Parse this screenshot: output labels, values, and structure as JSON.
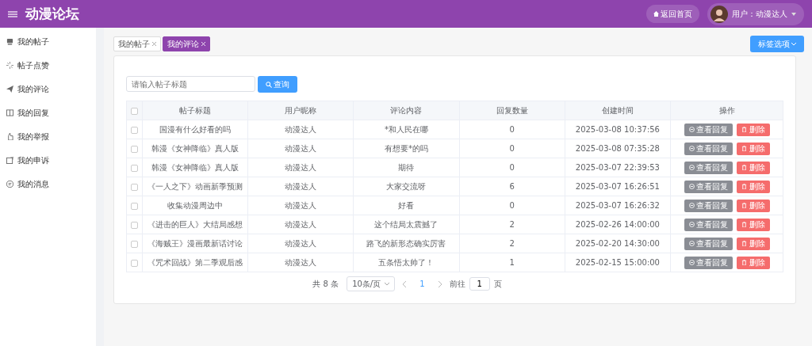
{
  "header": {
    "title": "动漫论坛",
    "home_button": "返回首页",
    "user_label": "用户：动漫达人"
  },
  "sidebar": {
    "items": [
      {
        "label": "我的帖子",
        "selected": false
      },
      {
        "label": "帖子点赞",
        "selected": false
      },
      {
        "label": "我的评论",
        "selected": false
      },
      {
        "label": "我的回复",
        "selected": false
      },
      {
        "label": "我的举报",
        "selected": false
      },
      {
        "label": "我的申诉",
        "selected": false
      },
      {
        "label": "我的消息",
        "selected": false
      }
    ]
  },
  "tabs": [
    {
      "label": "我的帖子",
      "selected": false
    },
    {
      "label": "我的评论",
      "selected": true
    }
  ],
  "tab_options_button": "标签选项",
  "search": {
    "placeholder": "请输入帖子标题",
    "button": "查询"
  },
  "table": {
    "select_all_checked": false,
    "columns": [
      "帖子标题",
      "用户昵称",
      "评论内容",
      "回复数量",
      "创建时间",
      "操作"
    ],
    "rows": [
      {
        "checked": false,
        "cells": [
          "国漫有什么好看的吗",
          "动漫达人",
          "*和人民在哪",
          "0",
          "2025-03-08 10:37:56"
        ],
        "view_button": "查看回复",
        "delete_button": "删除"
      },
      {
        "checked": false,
        "cells": [
          "韩漫《女神降临》真人版",
          "动漫达人",
          "有想要*的吗",
          "0",
          "2025-03-08 07:35:28"
        ],
        "view_button": "查看回复",
        "delete_button": "删除"
      },
      {
        "checked": false,
        "cells": [
          "韩漫《女神降临》真人版",
          "动漫达人",
          "期待",
          "0",
          "2025-03-07 22:39:53"
        ],
        "view_button": "查看回复",
        "delete_button": "删除"
      },
      {
        "checked": false,
        "cells": [
          "《一人之下》动画新季预测",
          "动漫达人",
          "大家交流呀",
          "6",
          "2025-03-07 16:26:51"
        ],
        "view_button": "查看回复",
        "delete_button": "删除"
      },
      {
        "checked": false,
        "cells": [
          "收集动漫周边中",
          "动漫达人",
          "好看",
          "0",
          "2025-03-07 16:26:32"
        ],
        "view_button": "查看回复",
        "delete_button": "删除"
      },
      {
        "checked": false,
        "cells": [
          "《进击的巨人》大结局感想",
          "动漫达人",
          "这个结局太震撼了",
          "2",
          "2025-02-26 14:00:00"
        ],
        "view_button": "查看回复",
        "delete_button": "删除"
      },
      {
        "checked": false,
        "cells": [
          "《海贼王》漫画最新话讨论",
          "动漫达人",
          "路飞的新形态确实厉害",
          "2",
          "2025-02-20 14:30:00"
        ],
        "view_button": "查看回复",
        "delete_button": "删除"
      },
      {
        "checked": false,
        "cells": [
          "《咒术回战》第二季观后感",
          "动漫达人",
          "五条悟太帅了！",
          "1",
          "2025-02-15 15:00:00"
        ],
        "view_button": "查看回复",
        "delete_button": "删除"
      }
    ]
  },
  "pagination": {
    "total": "共 8 条",
    "page_size": "10条/页",
    "pages": [
      {
        "label": "1",
        "selected": true
      }
    ],
    "goto_label": "前往",
    "goto_value": "1",
    "page_suffix": "页"
  }
}
